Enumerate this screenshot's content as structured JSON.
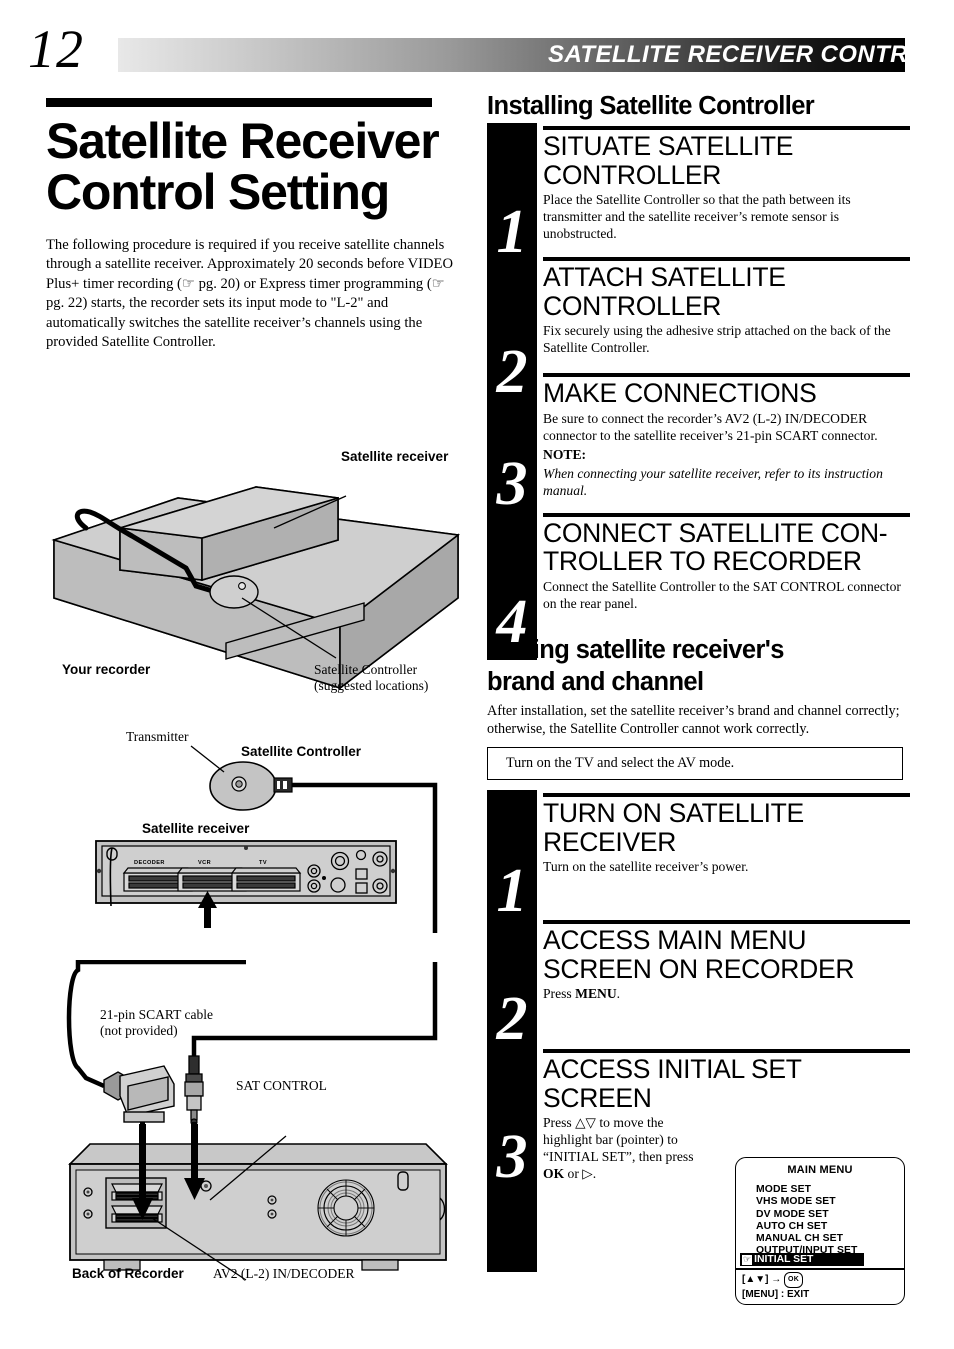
{
  "header": {
    "page_number": "12",
    "title": "SATELLITE RECEIVER CONTROL"
  },
  "left": {
    "doc_title": "Satellite Receiver Control Setting",
    "intro": "The following procedure is required if you receive satellite channels through a satellite receiver. Approximately 20 seconds before VIDEO Plus+ timer recording (☞ pg. 20) or Express timer programming (☞ pg. 22) starts, the recorder sets its input mode to \"L-2\" and automatically switches the satellite receiver’s channels using the provided Satellite Controller.",
    "fig1": {
      "label_satellite_receiver": "Satellite receiver",
      "label_your_recorder": "Your recorder",
      "label_controller_l1": "Satellite Controller",
      "label_controller_l2": "(suggested locations)"
    },
    "fig2": {
      "label_transmitter": "Transmitter",
      "label_controller": "Satellite Controller",
      "label_receiver": "Satellite receiver",
      "port_decoder": "DECODER",
      "port_vcr": "VCR",
      "port_tv": "TV"
    },
    "fig3": {
      "label_cable_l1": "21-pin SCART cable",
      "label_cable_l2": "(not provided)",
      "label_sat_control": "SAT CONTROL",
      "label_back_of_recorder": "Back of  Recorder",
      "label_av2": "AV2 (L-2) IN/DECODER"
    }
  },
  "right": {
    "section1": {
      "heading": "Installing Satellite Controller",
      "steps": [
        {
          "number": "1",
          "title": "SITUATE SATELLITE CONTROLLER",
          "body": "Place the Satellite Controller so that the path between its transmitter and the satellite receiver’s remote sensor is unobstructed."
        },
        {
          "number": "2",
          "title": "ATTACH SATELLITE CONTROLLER",
          "body": "Fix securely using the adhesive strip attached on the back of the Satellite Controller."
        },
        {
          "number": "3",
          "title": "MAKE CONNECTIONS",
          "body": "Be sure to connect the recorder’s AV2 (L-2) IN/DECODER connector to the satellite receiver’s 21-pin SCART connector.",
          "note_heading": "NOTE:",
          "note_body": "When connecting your satellite receiver, refer to its instruction manual."
        },
        {
          "number": "4",
          "title": "CONNECT SATELLITE CON-TROLLER TO RECORDER",
          "body": "Connect the Satellite Controller to the SAT CONTROL connector on the rear panel."
        }
      ]
    },
    "section2": {
      "heading_l1": "Setting satellite receiver's",
      "heading_l2": "brand and channel",
      "intro": "After installation, set the satellite receiver’s brand and channel correctly; otherwise, the Satellite Controller cannot work correctly.",
      "tv_box": "Turn on the TV and select the AV mode.",
      "steps": [
        {
          "number": "1",
          "title": "TURN ON SATELLITE RECEIVER",
          "body": "Turn on the satellite receiver’s power."
        },
        {
          "number": "2",
          "title": "ACCESS MAIN MENU SCREEN ON RECORDER",
          "body_pre": "Press ",
          "body_bold": "MENU",
          "body_post": "."
        },
        {
          "number": "3",
          "title": "ACCESS INITIAL SET SCREEN",
          "body_1": "Press △▽ to move the",
          "body_2": "highlight bar (pointer) to",
          "body_3": "“INITIAL SET”, then press",
          "body_4_bold": "OK",
          "body_4_post": " or ▷."
        }
      ]
    }
  },
  "osd": {
    "title": "MAIN MENU",
    "items": [
      "MODE SET",
      "VHS MODE SET",
      "DV MODE SET",
      "AUTO CH SET",
      "MANUAL CH SET",
      "OUTPUT/INPUT SET"
    ],
    "highlighted_item": "INITIAL SET",
    "pointer_glyph": "☞",
    "footer_line1_keys": "[▲▼]",
    "footer_line1_arrow": "→",
    "footer_line1_ok": "OK",
    "footer_line2": "[MENU] : EXIT"
  },
  "colors": {
    "ink": "#000000",
    "panel_gray": "#c0c0c0",
    "panel_dark": "#8a8a8a",
    "panel_light": "#e0e0e0"
  }
}
